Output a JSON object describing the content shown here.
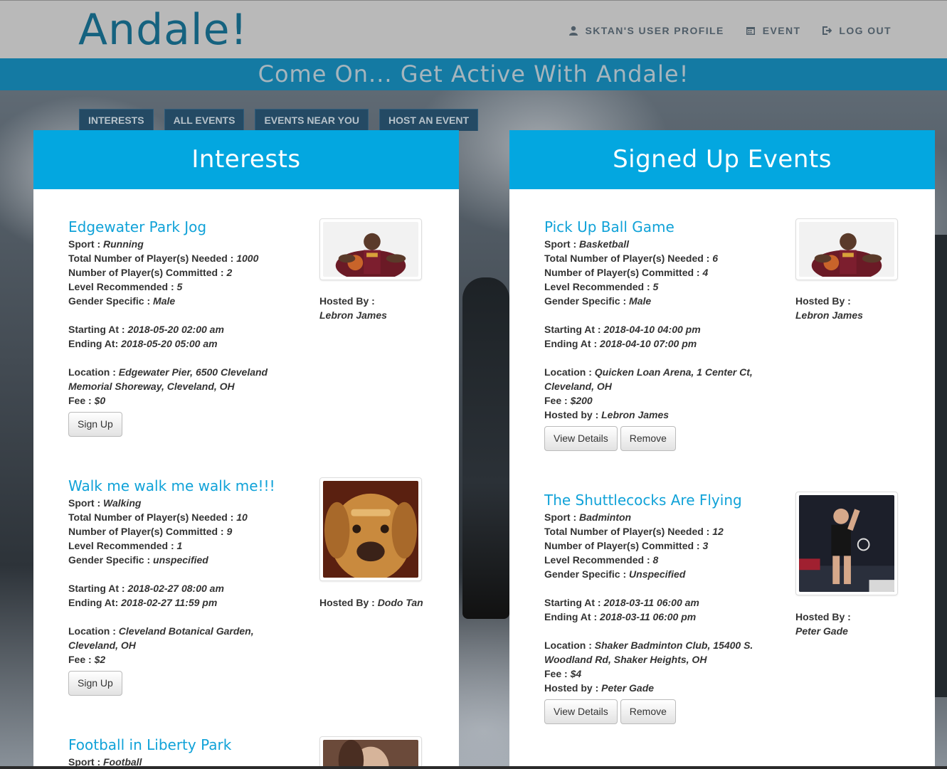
{
  "brand": {
    "logo": "Andale!",
    "tagline": "Come On... Get Active With Andale!"
  },
  "nav": [
    {
      "label": "SKTAN's USER PROFILE",
      "icon": "user-icon"
    },
    {
      "label": "EVENT",
      "icon": "calendar-icon"
    },
    {
      "label": "LOG OUT",
      "icon": "logout-icon"
    }
  ],
  "tabs": [
    "INTERESTS",
    "ALL EVENTS",
    "EVENTS NEAR YOU",
    "HOST AN EVENT"
  ],
  "interests": {
    "title": "Interests",
    "events": [
      {
        "title": "Edgewater Park Jog",
        "sport_label": "Sport : ",
        "sport": "Running",
        "needed_label": "Total Number of Player(s) Needed : ",
        "needed": "1000",
        "committed_label": "Number of Player(s) Committed : ",
        "committed": "2",
        "level_label": "Level Recommended : ",
        "level": "5",
        "gender_label": "Gender Specific : ",
        "gender": "Male",
        "start_label": "Starting At : ",
        "start": "2018-05-20 02:00 am",
        "end_label": "Ending At: ",
        "end": "2018-05-20 05:00 am",
        "location_label": "Location : ",
        "location": "Edgewater Pier, 6500 Cleveland Memorial Shoreway, Cleveland, OH",
        "fee_label": "Fee : ",
        "fee": "$0",
        "hosted_label": "Hosted By : ",
        "host": "Lebron James",
        "button": "Sign Up"
      },
      {
        "title": "Walk me walk me walk me!!!",
        "sport_label": "Sport : ",
        "sport": "Walking",
        "needed_label": "Total Number of Player(s) Needed : ",
        "needed": "10",
        "committed_label": "Number of Player(s) Committed : ",
        "committed": "9",
        "level_label": "Level Recommended : ",
        "level": "1",
        "gender_label": "Gender Specific : ",
        "gender": "unspecified",
        "start_label": "Starting At : ",
        "start": "2018-02-27 08:00 am",
        "end_label": "Ending At: ",
        "end": "2018-02-27 11:59 pm",
        "location_label": "Location : ",
        "location": "Cleveland Botanical Garden, Cleveland, OH",
        "fee_label": "Fee : ",
        "fee": "$2",
        "hosted_label": "Hosted By : ",
        "host": "Dodo Tan",
        "button": "Sign Up"
      },
      {
        "title": "Football in Liberty Park",
        "sport_label": "Sport : ",
        "sport": "Football"
      }
    ]
  },
  "signed": {
    "title": "Signed Up Events",
    "events": [
      {
        "title": "Pick Up Ball Game",
        "sport_label": "Sport : ",
        "sport": "Basketball",
        "needed_label": "Total Number of Player(s) Needed : ",
        "needed": "6",
        "committed_label": "Number of Player(s) Committed : ",
        "committed": "4",
        "level_label": "Level Recommended : ",
        "level": "5",
        "gender_label": "Gender Specific : ",
        "gender": "Male",
        "start_label": "Starting At : ",
        "start": "2018-04-10 04:00 pm",
        "end_label": "Ending At : ",
        "end": "2018-04-10 07:00 pm",
        "location_label": "Location : ",
        "location": "Quicken Loan Arena, 1 Center Ct, Cleveland, OH",
        "fee_label": "Fee : ",
        "fee": "$200",
        "hostedby_label": "Hosted by : ",
        "hostedby": "Lebron James",
        "hosted_label": "Hosted By : ",
        "host": "Lebron James",
        "btn_details": "View Details",
        "btn_remove": "Remove"
      },
      {
        "title": "The Shuttlecocks Are Flying",
        "sport_label": "Sport : ",
        "sport": "Badminton",
        "needed_label": "Total Number of Player(s) Needed : ",
        "needed": "12",
        "committed_label": "Number of Player(s) Committed : ",
        "committed": "3",
        "level_label": "Level Recommended : ",
        "level": "8",
        "gender_label": "Gender Specific : ",
        "gender": "Unspecified",
        "start_label": "Starting At : ",
        "start": "2018-03-11 06:00 am",
        "end_label": "Ending At : ",
        "end": "2018-03-11 06:00 pm",
        "location_label": "Location : ",
        "location": "Shaker Badminton Club, 15400 S. Woodland Rd, Shaker Heights, OH",
        "fee_label": "Fee : ",
        "fee": "$4",
        "hostedby_label": "Hosted by : ",
        "hostedby": "Peter Gade",
        "hosted_label": "Hosted By : ",
        "host": "Peter Gade",
        "btn_details": "View Details",
        "btn_remove": "Remove"
      }
    ]
  },
  "colors": {
    "accent": "#03a7e0",
    "banner": "#147aa3",
    "logo": "#15627f"
  }
}
